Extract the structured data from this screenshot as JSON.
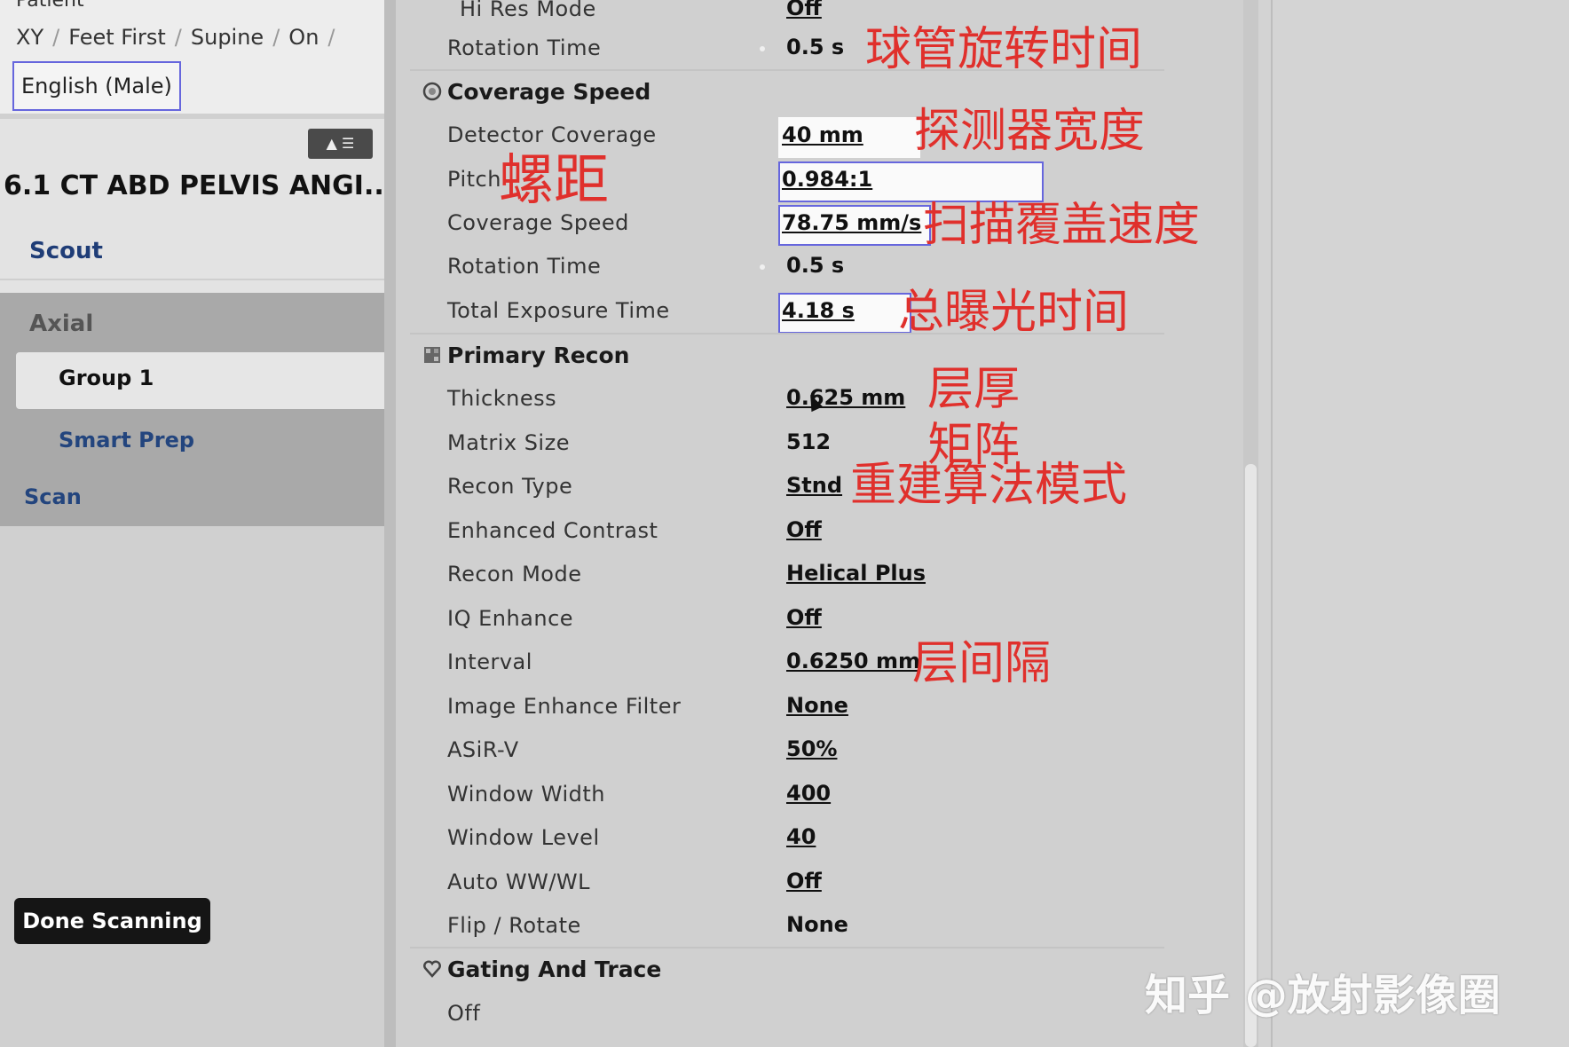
{
  "left": {
    "patient_label": "Patient",
    "breadcrumbs": [
      "XY",
      "Feet First",
      "Supine",
      "On"
    ],
    "language": "English (Male)",
    "protocol_title": "6.1 CT ABD PELVIS ANGI...",
    "steps": {
      "scout": "Scout",
      "axial": "Axial",
      "group1": "Group 1",
      "smart_prep": "Smart Prep",
      "scan": "Scan"
    },
    "done_button": "Done Scanning"
  },
  "params": {
    "hi_res_mode": {
      "label": "Hi Res Mode",
      "value": "Off"
    },
    "rotation_time_top": {
      "label": "Rotation Time",
      "value": "0.5 s"
    },
    "coverage_speed_section": "Coverage Speed",
    "detector_coverage": {
      "label": "Detector Coverage",
      "value": "40 mm"
    },
    "pitch": {
      "label": "Pitch",
      "value": "0.984:1"
    },
    "coverage_speed": {
      "label": "Coverage Speed",
      "value": "78.75 mm/s"
    },
    "rotation_time": {
      "label": "Rotation Time",
      "value": "0.5 s"
    },
    "total_exposure_time": {
      "label": "Total Exposure Time",
      "value": "4.18 s"
    },
    "primary_recon_section": "Primary Recon",
    "thickness": {
      "label": "Thickness",
      "value": "0.625 mm"
    },
    "matrix_size": {
      "label": "Matrix Size",
      "value": "512"
    },
    "recon_type": {
      "label": "Recon Type",
      "value": "Stnd"
    },
    "enhanced_contrast": {
      "label": "Enhanced Contrast",
      "value": "Off"
    },
    "recon_mode": {
      "label": "Recon Mode",
      "value": "Helical Plus"
    },
    "iq_enhance": {
      "label": "IQ Enhance",
      "value": "Off"
    },
    "interval": {
      "label": "Interval",
      "value": "0.6250 mm"
    },
    "image_enhance_filter": {
      "label": "Image Enhance Filter",
      "value": "None"
    },
    "asir_v": {
      "label": "ASiR-V",
      "value": "50%"
    },
    "window_width": {
      "label": "Window Width",
      "value": "400"
    },
    "window_level": {
      "label": "Window Level",
      "value": "40"
    },
    "auto_ww_wl": {
      "label": "Auto WW/WL",
      "value": "Off"
    },
    "flip_rotate": {
      "label": "Flip / Rotate",
      "value": "None"
    },
    "gating_section": "Gating And Trace",
    "gating_value": "Off"
  },
  "annotations": {
    "rotation_time": "球管旋转时间",
    "detector_width": "探测器宽度",
    "pitch": "螺距",
    "coverage_speed": "扫描覆盖速度",
    "total_exposure": "总曝光时间",
    "thickness": "层厚",
    "matrix": "矩阵",
    "recon_algorithm": "重建算法模式",
    "interval": "层间隔"
  },
  "watermark": "知乎 @放射影像圈",
  "colors": {
    "annotation": "#e0302c",
    "selection_border": "#6666dd",
    "nav_link": "#23457e"
  }
}
